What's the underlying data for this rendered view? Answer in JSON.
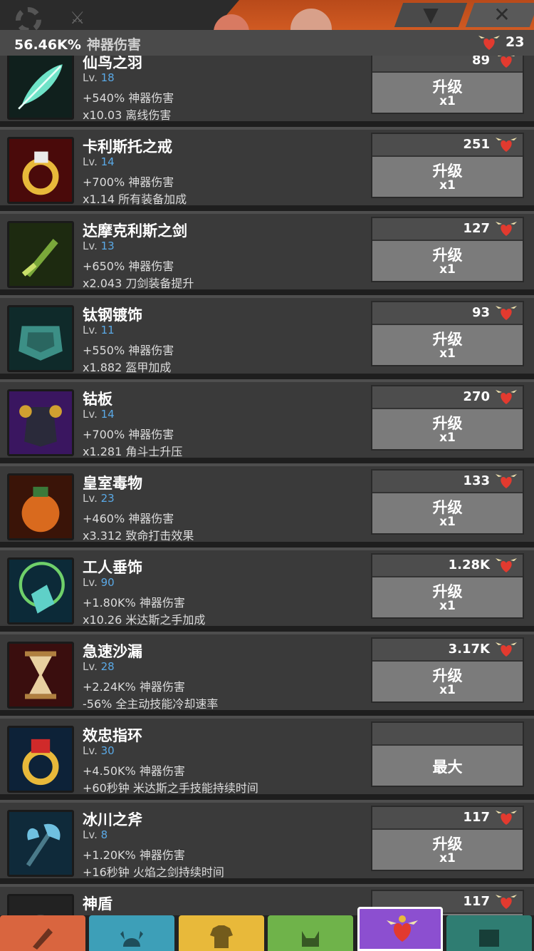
{
  "top_bar": {
    "dropdown_icon": "triangle-down-icon",
    "close_icon": "x-icon"
  },
  "stat_bar": {
    "damage_value": "56.46K%",
    "damage_label": "神器伤害",
    "hearts": "23"
  },
  "level_prefix": "Lv.",
  "artifacts": [
    {
      "name": "仙鸟之羽",
      "level": "18",
      "effect1": "+540% 神器伤害",
      "effect2": "x10.03 离线伤害",
      "cost": "89",
      "button": "升级",
      "mult": "x1",
      "icon": "feather-icon"
    },
    {
      "name": "卡利斯托之戒",
      "level": "14",
      "effect1": "+700% 神器伤害",
      "effect2": "x1.14 所有装备加成",
      "cost": "251",
      "button": "升级",
      "mult": "x1",
      "icon": "ring-icon"
    },
    {
      "name": "达摩克利斯之剑",
      "level": "13",
      "effect1": "+650% 神器伤害",
      "effect2": "x2.043 刀剑装备提升",
      "cost": "127",
      "button": "升级",
      "mult": "x1",
      "icon": "sword-icon"
    },
    {
      "name": "钛钢镀饰",
      "level": "11",
      "effect1": "+550% 神器伤害",
      "effect2": "x1.882 盔甲加成",
      "cost": "93",
      "button": "升级",
      "mult": "x1",
      "icon": "armor-icon"
    },
    {
      "name": "钴板",
      "level": "14",
      "effect1": "+700% 神器伤害",
      "effect2": "x1.281 角斗士升压",
      "cost": "270",
      "button": "升级",
      "mult": "x1",
      "icon": "breastplate-icon"
    },
    {
      "name": "皇室毒物",
      "level": "23",
      "effect1": "+460% 神器伤害",
      "effect2": "x3.312 致命打击效果",
      "cost": "133",
      "button": "升级",
      "mult": "x1",
      "icon": "poison-jar-icon"
    },
    {
      "name": "工人垂饰",
      "level": "90",
      "effect1": "+1.80K% 神器伤害",
      "effect2": "x10.26 米达斯之手加成",
      "cost": "1.28K",
      "button": "升级",
      "mult": "x1",
      "icon": "pendant-icon"
    },
    {
      "name": "急速沙漏",
      "level": "28",
      "effect1": "+2.24K% 神器伤害",
      "effect2": "-56% 全主动技能冷却速率",
      "cost": "3.17K",
      "button": "升级",
      "mult": "x1",
      "icon": "hourglass-icon"
    },
    {
      "name": "效忠指环",
      "level": "30",
      "effect1": "+4.50K% 神器伤害",
      "effect2": "+60秒钟 米达斯之手技能持续时间",
      "cost": "",
      "button": "最大",
      "mult": "",
      "icon": "red-gem-ring-icon"
    },
    {
      "name": "冰川之斧",
      "level": "8",
      "effect1": "+1.20K% 神器伤害",
      "effect2": "+16秒钟 火焰之剑持续时间",
      "cost": "117",
      "button": "升级",
      "mult": "x1",
      "icon": "axe-icon"
    },
    {
      "name": "神盾",
      "level": "",
      "effect1": "",
      "effect2": "",
      "cost": "117",
      "button": "",
      "mult": "",
      "icon": "shield-icon"
    }
  ],
  "bottom_nav": [
    {
      "name": "sword-tab",
      "icon": "sword-icon",
      "color": "#d9653f"
    },
    {
      "name": "heroes-tab",
      "icon": "viking-helmet-icon",
      "color": "#3d9fb8"
    },
    {
      "name": "equipment-tab",
      "icon": "shirt-icon",
      "color": "#e8b93a"
    },
    {
      "name": "pets-tab",
      "icon": "pet-icon",
      "color": "#6fb34a"
    },
    {
      "name": "artifacts-tab",
      "icon": "winged-heart-icon",
      "color": "#8c4fd0",
      "active": true
    },
    {
      "name": "shop-tab",
      "icon": "chest-icon",
      "color": "#2f7d72"
    }
  ],
  "colors": {
    "level_blue": "#5aa9e6",
    "button_grey": "#7b7b7b",
    "row_bg": "#3a3a3a"
  }
}
